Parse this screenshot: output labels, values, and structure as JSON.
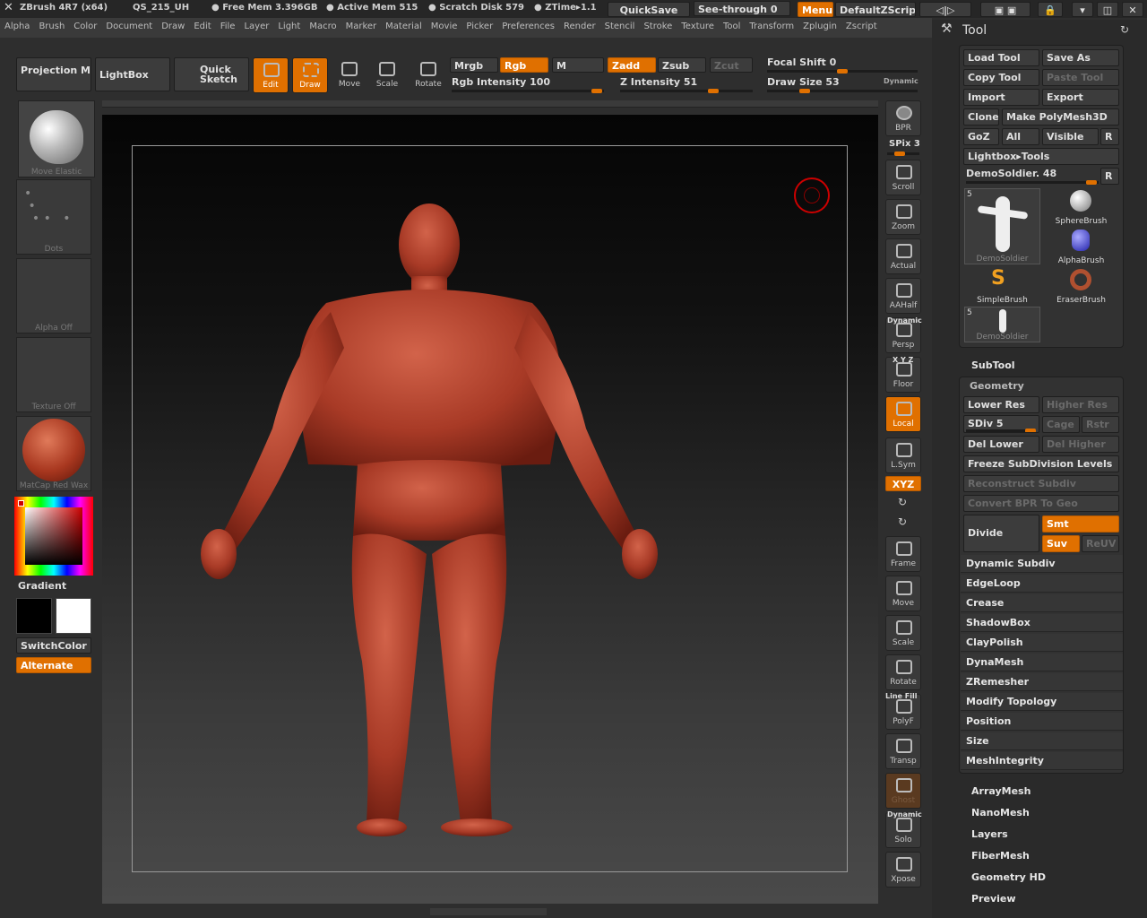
{
  "title_bar": {
    "app": "ZBrush 4R7 (x64)",
    "project": "QS_215_UH",
    "free_mem": "● Free Mem 3.396GB",
    "active_mem": "● Active Mem 515",
    "scratch": "● Scratch Disk 579",
    "ztime": "● ZTime▸1.1",
    "quicksave": "QuickSave",
    "see_through": "See-through",
    "see_through_value": "0",
    "menus": "Menus",
    "zscript": "DefaultZScript"
  },
  "menu": [
    "Alpha",
    "Brush",
    "Color",
    "Document",
    "Draw",
    "Edit",
    "File",
    "Layer",
    "Light",
    "Macro",
    "Marker",
    "Material",
    "Movie",
    "Picker",
    "Preferences",
    "Render",
    "Stencil",
    "Stroke",
    "Texture",
    "Tool",
    "Transform",
    "Zplugin",
    "Zscript"
  ],
  "shelf": {
    "projection_master": "Projection Master",
    "lightbox": "LightBox",
    "quick_sketch": "Quick Sketch",
    "edit": "Edit",
    "draw": "Draw",
    "move": "Move",
    "scale": "Scale",
    "rotate": "Rotate",
    "mrgb": "Mrgb",
    "rgb": "Rgb",
    "m": "M",
    "zadd": "Zadd",
    "zsub": "Zsub",
    "zcut": "Zcut",
    "rgb_intensity": "Rgb Intensity 100",
    "z_intensity": "Z Intensity 51",
    "focal_shift": "Focal Shift 0",
    "draw_size": "Draw Size 53",
    "dynamic": "Dynamic"
  },
  "left": {
    "brush": "Move Elastic",
    "stroke": "Dots",
    "alpha": "Alpha Off",
    "texture": "Texture Off",
    "material": "MatCap Red Wax",
    "gradient": "Gradient",
    "switch_color": "SwitchColor",
    "alternate": "Alternate"
  },
  "right_shelf": {
    "bpr": "BPR",
    "spix": "SPix 3",
    "scroll": "Scroll",
    "zoom": "Zoom",
    "actual": "Actual",
    "aahalf": "AAHalf",
    "dynamic": "Dynamic",
    "persp": "Persp",
    "xyz_small": "X Y Z",
    "floor": "Floor",
    "local": "Local",
    "lsym": "L.Sym",
    "xyz": "XYZ",
    "frame": "Frame",
    "move": "Move",
    "scale": "Scale",
    "rotate": "Rotate",
    "line_fill": "Line Fill",
    "polyf": "PolyF",
    "transp": "Transp",
    "ghost": "Ghost",
    "dynamic2": "Dynamic",
    "solo": "Solo",
    "xpose": "Xpose"
  },
  "tool": {
    "title": "Tool",
    "load": "Load Tool",
    "save": "Save As",
    "copy": "Copy Tool",
    "paste": "Paste Tool",
    "import": "Import",
    "export": "Export",
    "clone": "Clone",
    "make_polymesh": "Make PolyMesh3D",
    "goz": "GoZ",
    "all": "All",
    "visible": "Visible",
    "r": "R",
    "lightbox_tools": "Lightbox▸Tools",
    "current": "DemoSoldier. 48",
    "thumb_count": "5",
    "thumb1": "DemoSoldier",
    "thumb2": "SphereBrush",
    "thumb3": "AlphaBrush",
    "thumb4": "SimpleBrush",
    "thumb5": "EraserBrush",
    "thumb6": "DemoSoldier",
    "thumb6_count": "5"
  },
  "subtool": "SubTool",
  "geometry": {
    "title": "Geometry",
    "lower_res": "Lower Res",
    "higher_res": "Higher Res",
    "sdiv": "SDiv 5",
    "cage": "Cage",
    "rstr": "Rstr",
    "del_lower": "Del Lower",
    "del_higher": "Del Higher",
    "freeze": "Freeze SubDivision Levels",
    "reconstruct": "Reconstruct Subdiv",
    "convert_bpr": "Convert BPR To Geo",
    "divide": "Divide",
    "smt": "Smt",
    "suv": "Suv",
    "reuv": "ReUV",
    "items": [
      "Dynamic Subdiv",
      "EdgeLoop",
      "Crease",
      "ShadowBox",
      "ClayPolish",
      "DynaMesh",
      "ZRemesher",
      "Modify Topology",
      "Position",
      "Size",
      "MeshIntegrity"
    ]
  },
  "tool_sections": [
    "ArrayMesh",
    "NanoMesh",
    "Layers",
    "FiberMesh",
    "Geometry HD",
    "Preview"
  ],
  "colors": {
    "accent": "#e07000",
    "model": "#b5402c"
  }
}
